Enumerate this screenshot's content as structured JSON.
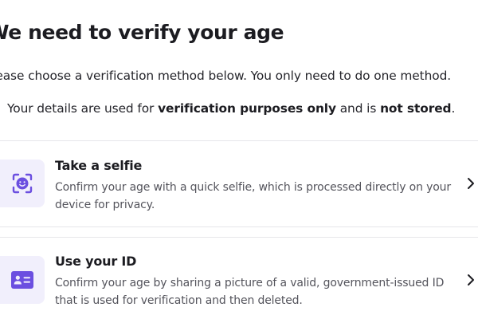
{
  "header": {
    "title": "We need to verify your age"
  },
  "intro": {
    "instructions": "Please choose a verification method below. You only need to do one method.",
    "privacy_prefix": "Your details are used for ",
    "privacy_bold_1": "verification purposes only",
    "privacy_middle": " and is ",
    "privacy_bold_2": "not stored",
    "privacy_suffix": "."
  },
  "options": [
    {
      "title": "Take a selfie",
      "description": "Confirm your age with a quick selfie, which is processed directly on your device for privacy.",
      "icon": "face-scan-icon"
    },
    {
      "title": "Use your ID",
      "description": "Confirm your age by sharing a picture of a valid, government-issued ID that is used for verification and then deleted.",
      "icon": "id-card-icon"
    }
  ],
  "colors": {
    "accent": "#6b4fe0",
    "icon_tile_bg": "#f1effc",
    "divider": "#e6e6ea",
    "title_text": "#1c1c21",
    "body_text": "#54545c"
  }
}
